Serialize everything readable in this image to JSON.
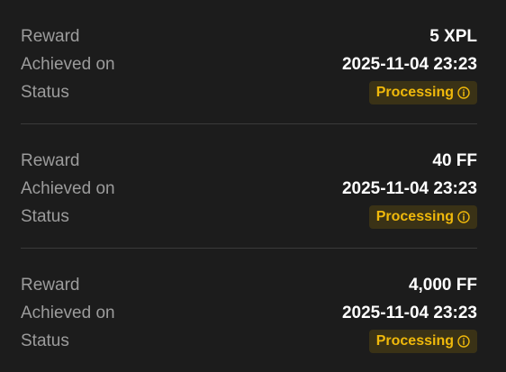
{
  "records": [
    {
      "reward_label": "Reward",
      "reward_value": "5 XPL",
      "achieved_label": "Achieved on",
      "achieved_value": "2025-11-04 23:23",
      "status_label": "Status",
      "status_value": "Processing",
      "status_icon": "info-icon"
    },
    {
      "reward_label": "Reward",
      "reward_value": "40 FF",
      "achieved_label": "Achieved on",
      "achieved_value": "2025-11-04 23:23",
      "status_label": "Status",
      "status_value": "Processing",
      "status_icon": "info-icon"
    },
    {
      "reward_label": "Reward",
      "reward_value": "4,000 FF",
      "achieved_label": "Achieved on",
      "achieved_value": "2025-11-04 23:23",
      "status_label": "Status",
      "status_value": "Processing",
      "status_icon": "info-icon"
    }
  ],
  "colors": {
    "background": "#1c1c1c",
    "label": "#9c9c9c",
    "value": "#ffffff",
    "status_text": "#f0b90b",
    "status_bg": "#3a3216",
    "divider": "#3a3a3a"
  }
}
